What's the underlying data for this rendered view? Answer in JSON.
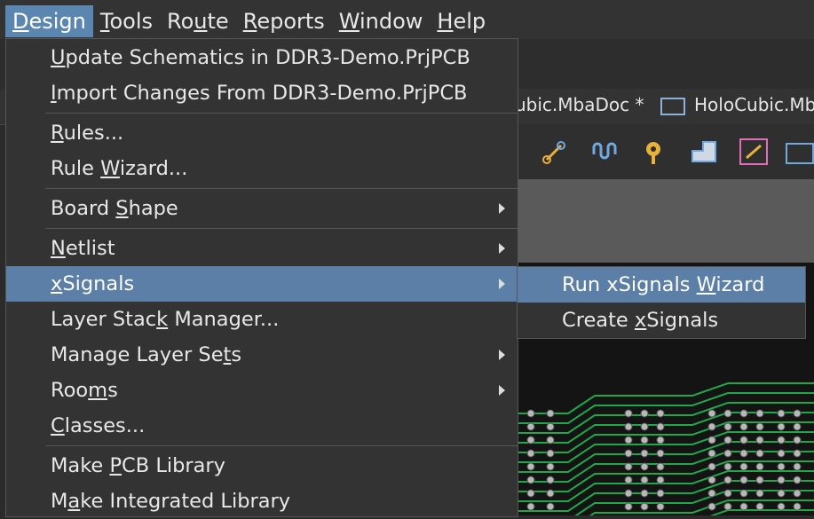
{
  "menubar": {
    "items": [
      {
        "pre": "",
        "key": "D",
        "post": "esign"
      },
      {
        "pre": "",
        "key": "T",
        "post": "ools"
      },
      {
        "pre": "Ro",
        "key": "u",
        "post": "te"
      },
      {
        "pre": "",
        "key": "R",
        "post": "eports"
      },
      {
        "pre": "",
        "key": "W",
        "post": "indow"
      },
      {
        "pre": "",
        "key": "H",
        "post": "elp"
      }
    ]
  },
  "doc_tabs": {
    "tab1": "ubic.MbaDoc *",
    "tab2": "HoloCubic.Mb"
  },
  "design_menu": {
    "items": [
      {
        "pre": "",
        "key": "U",
        "post": "pdate Schematics in DDR3-Demo.PrjPCB"
      },
      {
        "pre": "",
        "key": "I",
        "post": "mport Changes From DDR3-Demo.PrjPCB"
      },
      {
        "pre": "",
        "key": "R",
        "post": "ules..."
      },
      {
        "pre": "Rule ",
        "key": "W",
        "post": "izard..."
      },
      {
        "pre": "Board ",
        "key": "S",
        "post": "hape"
      },
      {
        "pre": "",
        "key": "N",
        "post": "etlist"
      },
      {
        "pre": "",
        "key": "x",
        "post": "Signals"
      },
      {
        "pre": "Layer Stac",
        "key": "k",
        "post": " Manager..."
      },
      {
        "pre": "Manage Layer Se",
        "key": "t",
        "post": "s"
      },
      {
        "pre": "Roo",
        "key": "m",
        "post": "s"
      },
      {
        "pre": "",
        "key": "C",
        "post": "lasses..."
      },
      {
        "pre": "Make ",
        "key": "P",
        "post": "CB Library"
      },
      {
        "pre": "M",
        "key": "a",
        "post": "ke Integrated Library"
      }
    ]
  },
  "xsignals_submenu": {
    "items": [
      {
        "pre": "Run xSignals ",
        "key": "W",
        "post": "izard"
      },
      {
        "pre": "Create ",
        "key": "x",
        "post": "Signals"
      }
    ]
  },
  "colors": {
    "menu_bg": "#333333",
    "selection": "#5b7fa6",
    "menubar_active": "#5b86b0",
    "pcb_trace": "#1fa84a"
  },
  "icons": [
    "route-icon",
    "tune-icon",
    "via-icon",
    "polygon-icon",
    "pad-icon",
    "text-icon"
  ]
}
